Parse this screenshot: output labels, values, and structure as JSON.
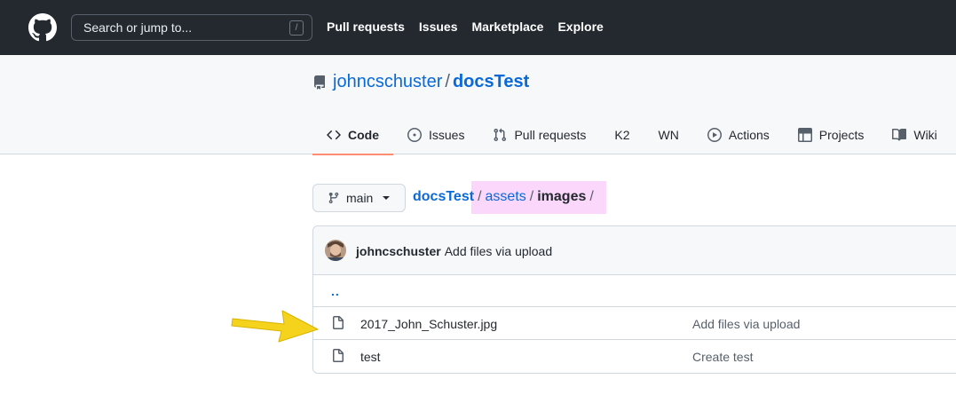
{
  "header": {
    "search_placeholder": "Search or jump to...",
    "search_shortcut": "/",
    "nav": [
      "Pull requests",
      "Issues",
      "Marketplace",
      "Explore"
    ]
  },
  "repo": {
    "owner": "johncschuster",
    "separator": "/",
    "name": "docsTest"
  },
  "tabs": [
    {
      "label": "Code",
      "icon": "code-icon",
      "selected": true
    },
    {
      "label": "Issues",
      "icon": "issue-opened-icon"
    },
    {
      "label": "Pull requests",
      "icon": "git-pull-request-icon"
    },
    {
      "label": "K2"
    },
    {
      "label": "WN"
    },
    {
      "label": "Actions",
      "icon": "play-icon"
    },
    {
      "label": "Projects",
      "icon": "table-icon"
    },
    {
      "label": "Wiki",
      "icon": "book-icon"
    }
  ],
  "branch": {
    "label": "main",
    "icon": "git-branch-icon"
  },
  "breadcrumb": {
    "root": "docsTest",
    "sep": "/",
    "segment1": "assets",
    "segment2": "images"
  },
  "latest_commit": {
    "author": "johncschuster",
    "message": "Add files via upload"
  },
  "files": {
    "parent_dir": "..",
    "items": [
      {
        "name": "2017_John_Schuster.jpg",
        "commit": "Add files via upload",
        "icon": "file-icon"
      },
      {
        "name": "test",
        "commit": "Create test",
        "icon": "file-icon"
      }
    ]
  },
  "colors": {
    "header_bg": "#24292f",
    "link": "#0969da",
    "tab_underline": "#fd8c73",
    "breadcrumb_highlight": "#fbd8fb",
    "annotation_arrow": "#f5d21b"
  }
}
